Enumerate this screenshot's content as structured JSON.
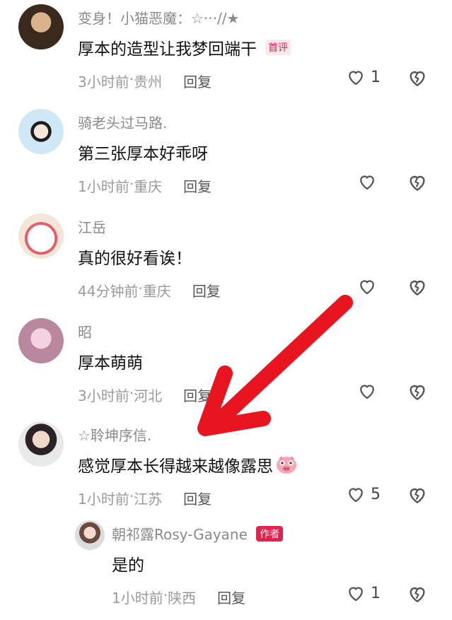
{
  "comments": [
    {
      "username": "变身！小猫恶魔：☆···//★",
      "content": "厚本的造型让我梦回端干",
      "badge": "首评",
      "time": "3小时前",
      "location": "贵州",
      "reply": "回复",
      "likes": "1"
    },
    {
      "username": "骑老头过马路.",
      "content": "第三张厚本好乖呀",
      "time": "1小时前",
      "location": "重庆",
      "reply": "回复",
      "likes": ""
    },
    {
      "username": "江岳",
      "content": "真的很好看诶！",
      "time": "44分钟前",
      "location": "重庆",
      "reply": "回复",
      "likes": ""
    },
    {
      "username": "昭",
      "content": "厚本萌萌",
      "time": "3小时前",
      "location": "河北",
      "reply": "回复",
      "likes": ""
    },
    {
      "username": "☆聆坤序信.",
      "content": "感觉厚本长得越来越像露思",
      "time": "1小时前",
      "location": "江苏",
      "reply": "回复",
      "likes": "5"
    }
  ],
  "reply": {
    "username": "朝祁露Rosy-Gayane",
    "badge": "作者",
    "content": "是的",
    "time": "1小时前",
    "location": "陕西",
    "reply": "回复",
    "likes": "1"
  },
  "separator": " · ",
  "icons": {
    "like": "heart-outline-icon",
    "dislike": "broken-heart-icon",
    "emoji": "pig-face-emoji"
  },
  "colors": {
    "accent": "#e2214d",
    "arrow": "#e8141f"
  }
}
